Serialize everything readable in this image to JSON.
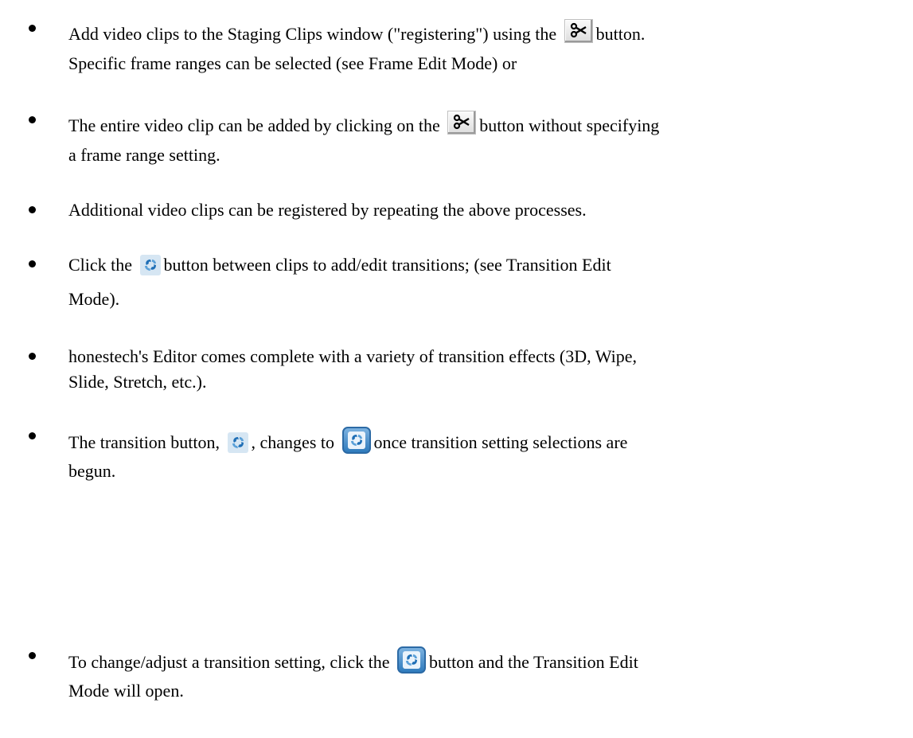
{
  "bullets": [
    {
      "parts": [
        "Add video clips to the Staging Clips window (\"registering\") using the",
        "button.",
        "Specific frame ranges can be selected (see Frame Edit Mode) or"
      ]
    },
    {
      "parts": [
        "The entire video clip can be added by clicking on the",
        "button without specifying",
        "a frame range setting."
      ]
    },
    {
      "parts": [
        "Additional video clips can be registered by repeating the above processes."
      ]
    },
    {
      "parts": [
        "Click the",
        "button between clips to add/edit transitions; (see Transition Edit",
        "Mode)."
      ]
    },
    {
      "parts": [
        "honestech's Editor comes complete with a variety of transition effects (3D, Wipe,",
        "Slide, Stretch, etc.)."
      ]
    },
    {
      "parts": [
        "The transition button,",
        ", changes to",
        "once transition setting selections are",
        "begun."
      ]
    },
    {
      "parts": [
        "To change/adjust a transition setting, click the",
        "button and the Transition Edit",
        "Mode will open."
      ]
    }
  ],
  "icons": {
    "scissors": "scissors-icon",
    "transition_small": "transition-icon",
    "transition_active": "transition-active-icon"
  },
  "colors": {
    "text": "#000000",
    "transition_blue": "#2f7bbd",
    "transition_light": "#d6e6f3"
  }
}
